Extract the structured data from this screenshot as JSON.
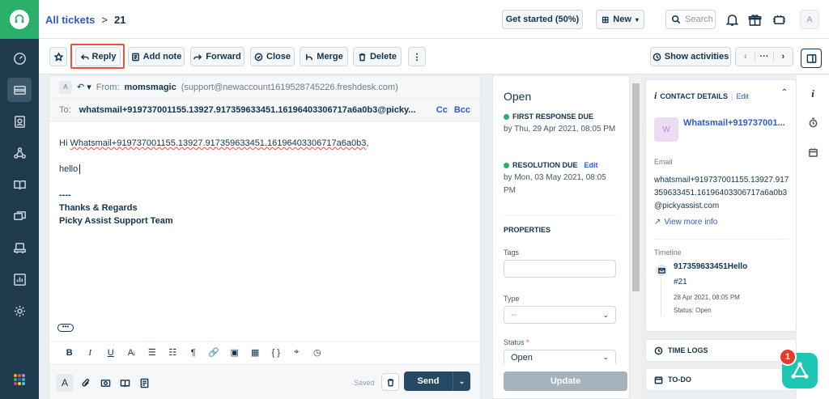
{
  "header": {
    "breadcrumb_link": "All tickets",
    "breadcrumb_sep": ">",
    "ticket_number": "21",
    "get_started": "Get started (50%)",
    "new_button": "New",
    "search_placeholder": "Search",
    "avatar_initial": "A"
  },
  "toolbar": {
    "reply": "Reply",
    "add_note": "Add note",
    "forward": "Forward",
    "close": "Close",
    "merge": "Merge",
    "delete": "Delete",
    "more": "⋮",
    "show_activities": "Show activities",
    "pager_more": "···"
  },
  "editor": {
    "from_initial": "A",
    "from_label": "From:",
    "from_name": "momsmagic",
    "from_address": "(support@newaccount1619528745226.freshdesk.com)",
    "to_label": "To:",
    "to_address": "whatsmail+919737001155.13927.917359633451.16196403306717a6a0b3@picky...",
    "cc": "Cc",
    "bcc": "Bcc",
    "greeting_prefix": "Hi ",
    "greeting_name": "Whatsmail+919737001155.13927.917359633451.16196403306717a6a0b3",
    "greeting_suffix": ",",
    "message": "hello",
    "sig_dashes": "----",
    "sig_regards": "Thanks & Regards",
    "sig_team": "Picky Assist Support Team",
    "ellipsis": "•••",
    "format_tools": [
      "B",
      "I",
      "U",
      "Aᵢ",
      "☰",
      "☷",
      "¶",
      "🔗",
      "▣",
      "▦",
      "{ }",
      "⌖",
      "◷"
    ],
    "saved": "Saved",
    "send": "Send",
    "send_dropdown": "⌄"
  },
  "properties": {
    "status": "Open",
    "first_response_label": "FIRST RESPONSE DUE",
    "first_response_value": "by Thu, 29 Apr 2021, 08:05 PM",
    "resolution_label": "RESOLUTION DUE",
    "resolution_edit": "Edit",
    "resolution_value": "by Mon, 03 May 2021, 08:05 PM",
    "section_title": "PROPERTIES",
    "tags_label": "Tags",
    "type_label": "Type",
    "type_value": "--",
    "status_label": "Status",
    "status_required": "*",
    "status_value": "Open",
    "update": "Update"
  },
  "contact": {
    "title": "CONTACT DETAILS",
    "sep": "|",
    "edit": "Edit",
    "avatar": "W",
    "name": "Whatsmail+919737001...",
    "email_label": "Email",
    "email_value": "whatsmail+919737001155.13927.917359633451.16196403306717a6a0b3@pickyassist.com",
    "view_more": "View more info",
    "timeline_label": "Timeline",
    "timeline_title": "917359633451Hello",
    "timeline_id": "#21",
    "timeline_date": "28 Apr 2021, 08:05 PM",
    "timeline_status": "Status: Open"
  },
  "time_logs": "TIME LOGS",
  "todo": "TO-DO",
  "fab_badge": "1",
  "colors": {
    "brand_green": "#2ab06a",
    "nav_bg": "#1f3a4d",
    "link_blue": "#2c5cc5",
    "send_bg": "#264966",
    "highlight": "#e8533a",
    "fab": "#1ec6b4"
  }
}
